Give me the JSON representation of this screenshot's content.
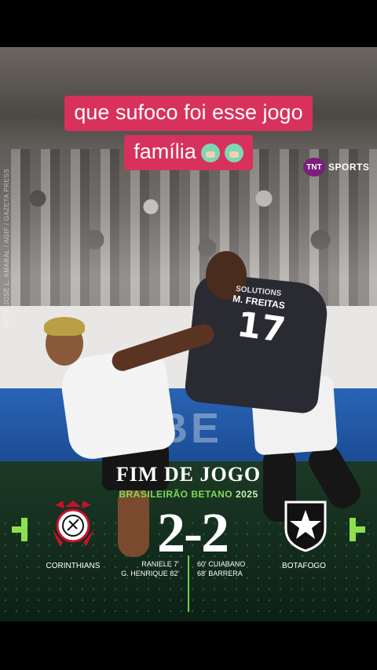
{
  "caption": {
    "line1": "que sufoco foi esse jogo",
    "line2": "família"
  },
  "brand": {
    "badge": "TNT",
    "name": "SPORTS"
  },
  "photo_credit": "FOTO: JOSÉ L. AMARAL / AGIF / GAZETA PRESS",
  "player": {
    "number": "17",
    "name": "M. FREITAS",
    "sponsor": "SOLUTIONS"
  },
  "board_text": "BE",
  "result": {
    "title": "FIM DE JOGO",
    "competition": "BRASILEIRÃO BETANO",
    "year": "2025",
    "home": {
      "name": "CORINTHIANS",
      "goals": "2",
      "scorers": [
        "RANIELE 7'",
        "G. HENRIQUE 82'"
      ]
    },
    "away": {
      "name": "BOTAFOGO",
      "goals": "2",
      "scorers": [
        "60' CUIABANO",
        "68' BARRERA"
      ]
    },
    "separator": "-"
  },
  "colors": {
    "caption_bg": "#d8315b",
    "accent_green": "#7fd85a",
    "brand_purple": "#7a1f7a"
  },
  "icons": [
    "emoji-face-icon",
    "corinthians-crest-icon",
    "botafogo-crest-icon",
    "nav-left-icon",
    "nav-right-icon"
  ]
}
